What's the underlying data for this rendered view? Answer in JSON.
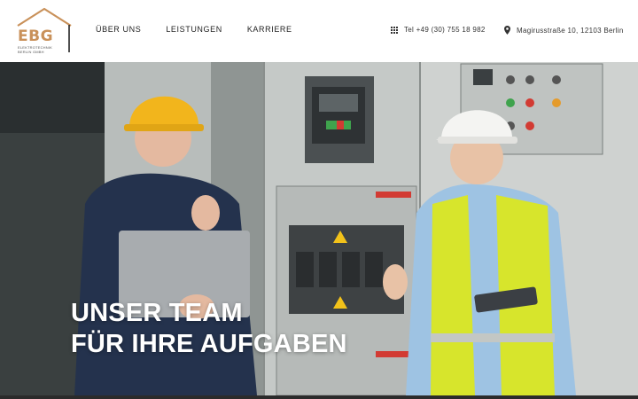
{
  "brand": {
    "logo_letters": "EBG",
    "logo_subtitle_line1": "ELEKTROTECHNIK",
    "logo_subtitle_line2": "BERLIN GMBH"
  },
  "nav": {
    "items": [
      {
        "label": "ÜBER UNS"
      },
      {
        "label": "LEISTUNGEN"
      },
      {
        "label": "KARRIERE"
      }
    ]
  },
  "contact": {
    "phone": "Tel +49 (30) 755 18 982",
    "phone_icon": "grid-dial-icon",
    "address": "Magirusstraße 10, 12103 Berlin",
    "address_icon": "map-pin-icon"
  },
  "hero": {
    "headline_line1": "UNSER TEAM",
    "headline_line2": "FÜR IHRE AUFGABEN"
  },
  "colors": {
    "brand_accent": "#c9915a",
    "headline_text": "#ffffff",
    "header_bg": "#ffffff"
  }
}
